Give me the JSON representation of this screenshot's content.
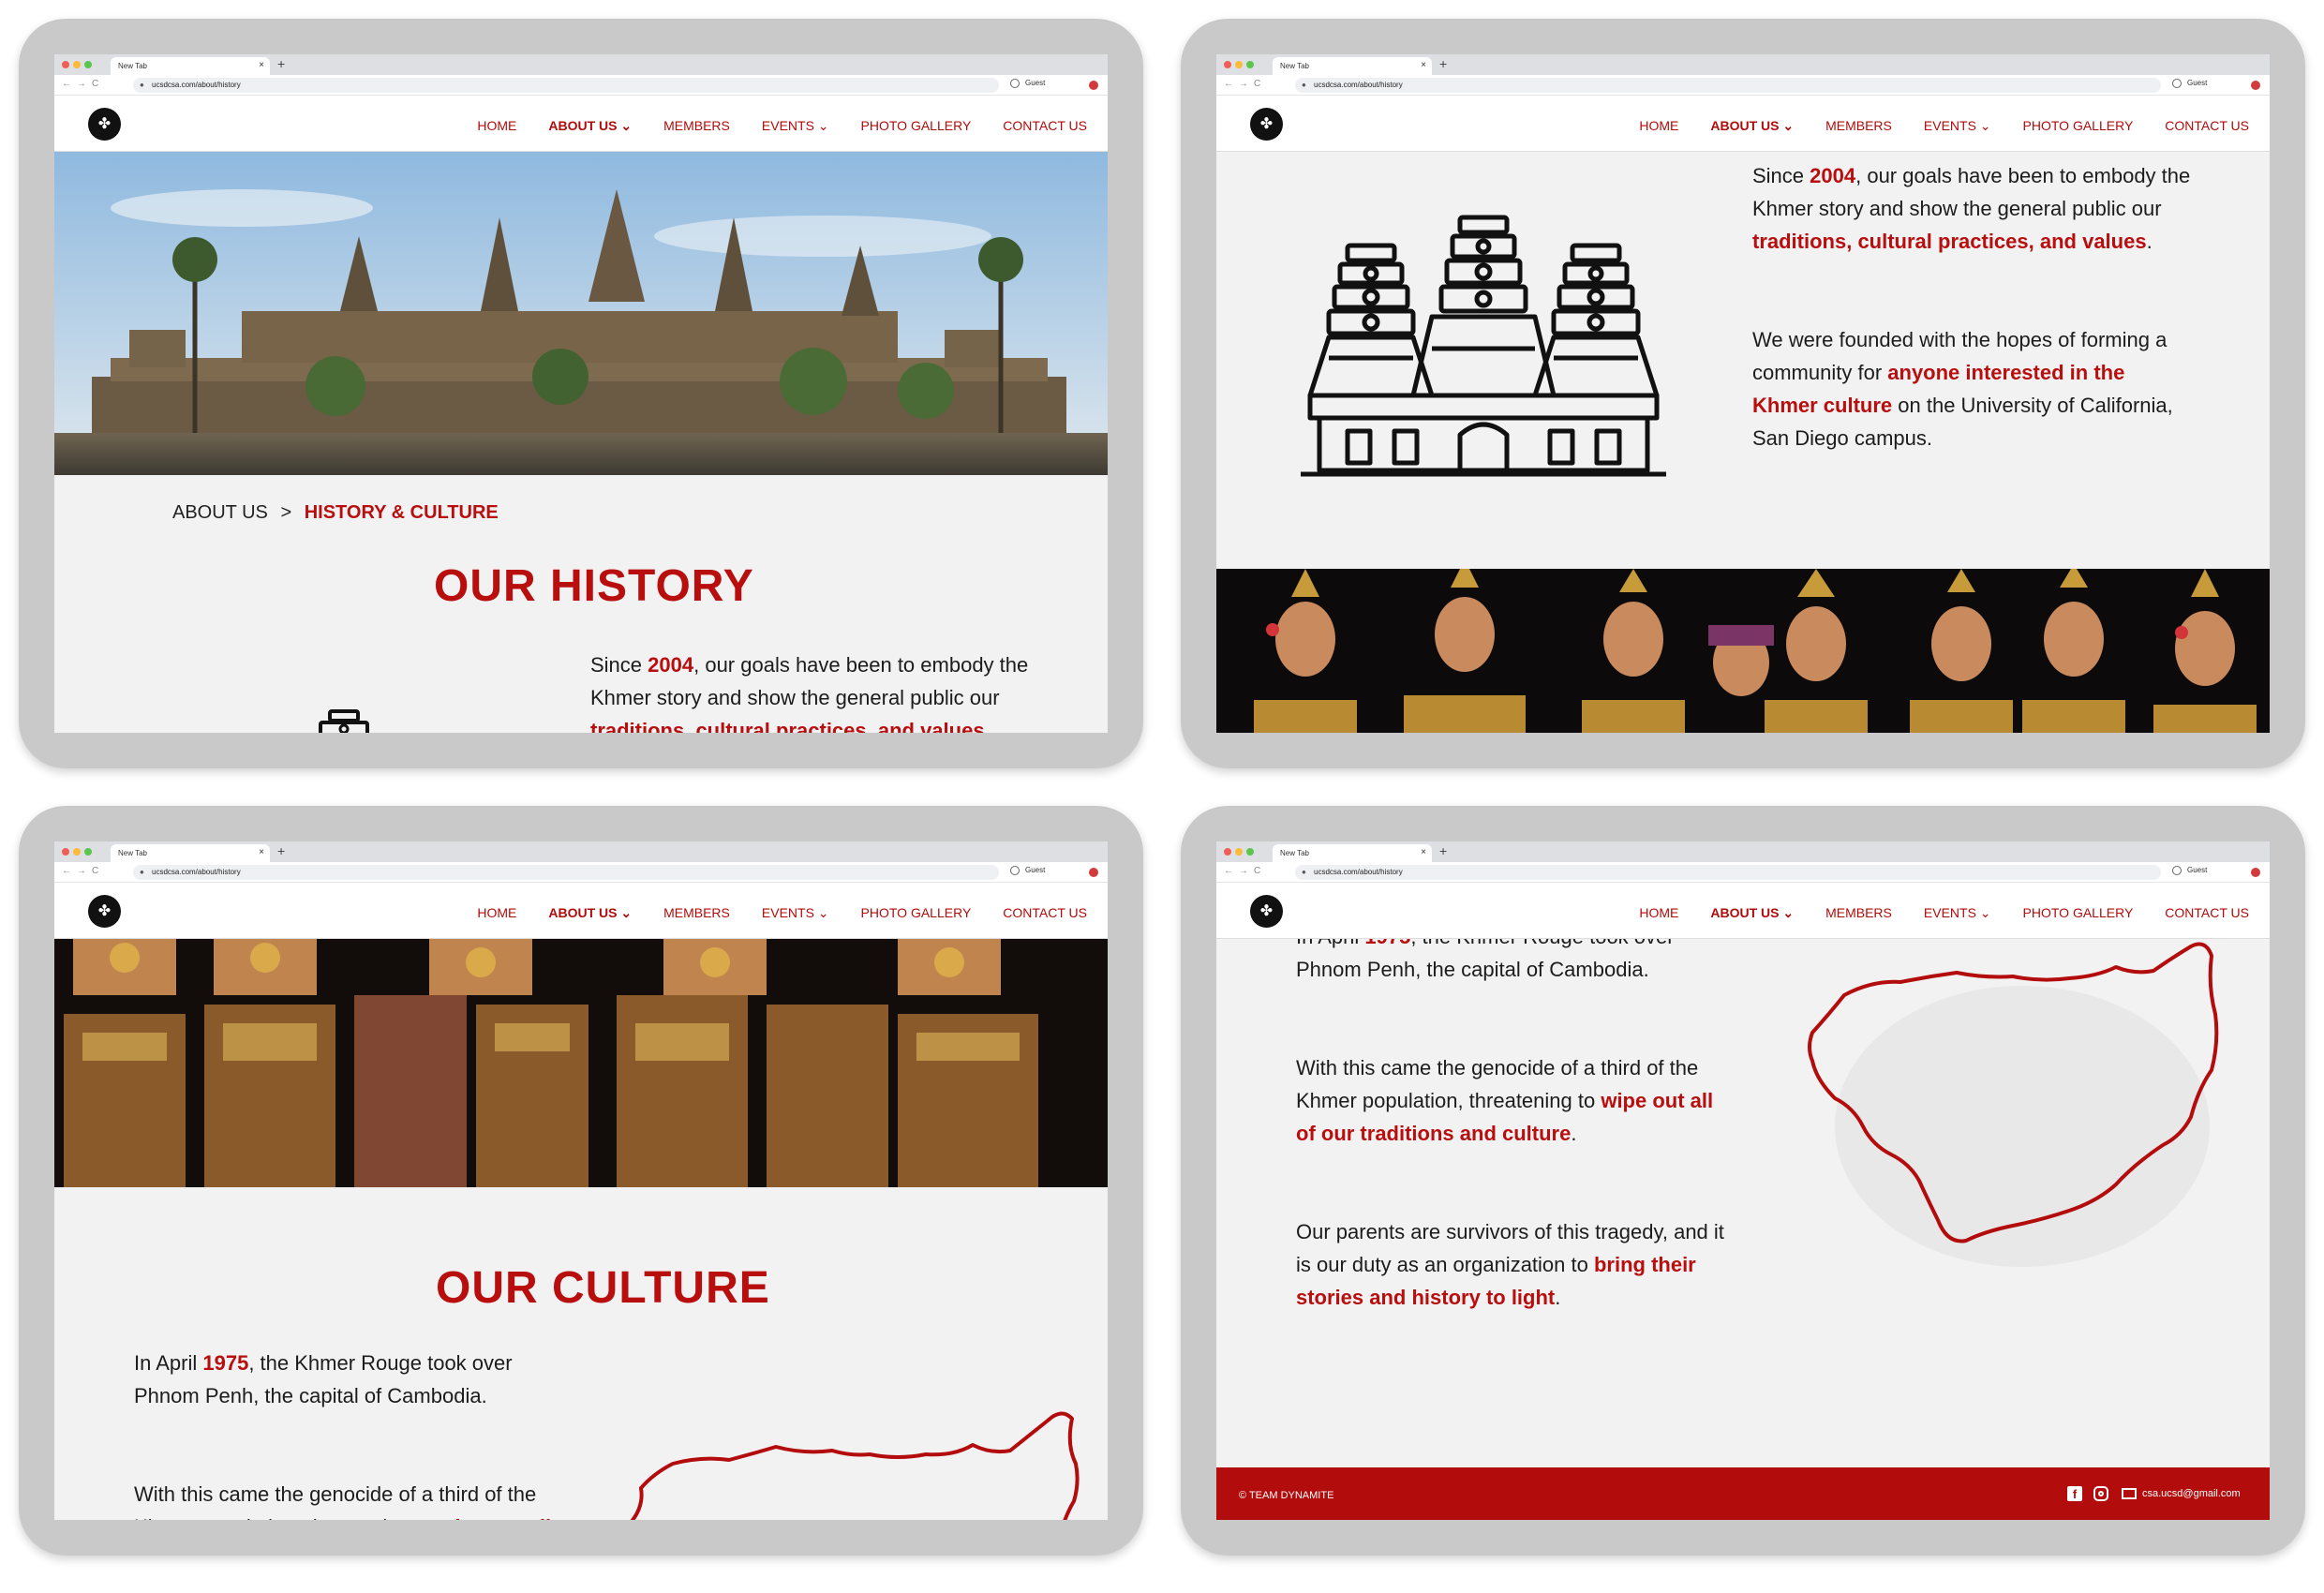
{
  "browser": {
    "tab_title": "New Tab",
    "tab_close": "×",
    "new_tab": "+",
    "url": "ucsdcsa.com/about/history",
    "profile": "Guest",
    "nav_back": "←",
    "nav_forward": "→",
    "nav_reload": "C"
  },
  "nav": {
    "logo_glyph": "✤",
    "home": "HOME",
    "about": "ABOUT US",
    "members": "MEMBERS",
    "events": "EVENTS",
    "gallery": "PHOTO GALLERY",
    "contact": "CONTACT US",
    "chevron": "⌄"
  },
  "breadcrumb": {
    "parent": "ABOUT US",
    "separator": ">",
    "current": "HISTORY & CULTURE"
  },
  "history": {
    "title": "OUR HISTORY",
    "p1_a": "Since ",
    "p1_year": "2004",
    "p1_b": ", our goals have been to embody the Khmer story and show the general public our ",
    "p1_highlight": "traditions, cultural practices, and values",
    "p1_c": ".",
    "p2_a": "We were founded with the hopes of forming a community for ",
    "p2_highlight": "anyone interested in the Khmer culture",
    "p2_b": " on the University of California, San Diego campus."
  },
  "culture": {
    "title": "OUR CULTURE",
    "p1_a": "In April ",
    "p1_year": "1975",
    "p1_b": ", the Khmer Rouge took over Phnom Penh, the capital of Cambodia.",
    "p2_a": "With this came the genocide of a third of the Khmer population,  threatening to ",
    "p2_highlight": "wipe out all of our traditions and culture",
    "p2_b": ".",
    "p3_a": "Our parents are survivors of this tragedy, and it is our duty as an organization to ",
    "p3_highlight": "bring their stories and history to light",
    "p3_b": "."
  },
  "footer": {
    "copyright": "© TEAM DYNAMITE",
    "facebook_glyph": "f",
    "email": "csa.ucsd@gmail.com"
  },
  "colors": {
    "brand_red": "#b80e0e",
    "footer_red": "#b30c0c",
    "panel_gray": "#c9c9c9"
  }
}
